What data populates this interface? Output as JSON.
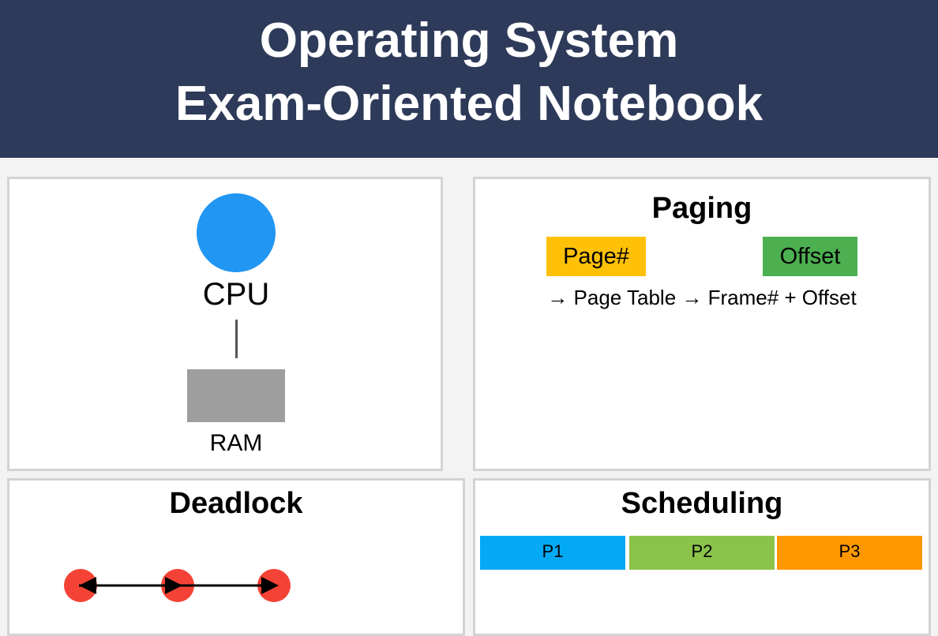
{
  "header": {
    "title_line1": "Operating System",
    "title_line2": "Exam-Oriented Notebook",
    "background": "#2e3a59"
  },
  "architecture": {
    "cpu_label": "CPU",
    "ram_label": "RAM",
    "cpu_color": "#2196f3",
    "ram_color": "#9e9e9e"
  },
  "paging": {
    "title": "Paging",
    "page_label": "Page#",
    "offset_label": "Offset",
    "flow": "→ Page Table → Frame# + Offset",
    "page_color": "#ffc107",
    "offset_color": "#4caf50"
  },
  "deadlock": {
    "title": "Deadlock",
    "node_color": "#f44336"
  },
  "scheduling": {
    "title": "Scheduling",
    "processes": [
      {
        "label": "P1",
        "color": "#03a9f4"
      },
      {
        "label": "P2",
        "color": "#8bc34a"
      },
      {
        "label": "P3",
        "color": "#ff9800"
      }
    ]
  }
}
